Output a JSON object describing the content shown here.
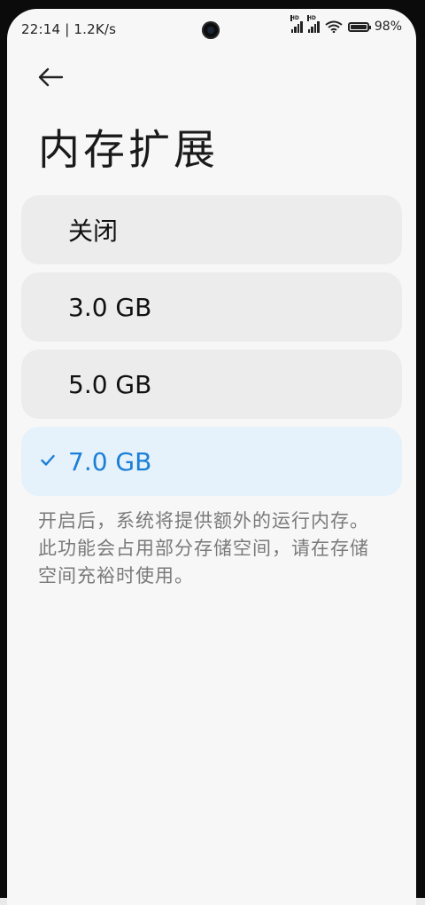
{
  "status_bar": {
    "time_speed": "22:14 | 1.2K/s",
    "battery_percent": "98%",
    "battery_level": 0.98,
    "signal_badge": "HD"
  },
  "page": {
    "title": "内存扩展",
    "back_icon": "arrow-left-icon"
  },
  "options": [
    {
      "label": "关闭",
      "selected": false
    },
    {
      "label": "3.0 GB",
      "selected": false
    },
    {
      "label": "5.0 GB",
      "selected": false
    },
    {
      "label": "7.0 GB",
      "selected": true
    }
  ],
  "description": "开启后，系统将提供额外的运行内存。此功能会占用部分存储空间，请在存储空间充裕时使用。",
  "colors": {
    "accent": "#1a7fd6",
    "selected_bg": "#e5f1fb",
    "option_bg": "#ececec",
    "description": "#7a7a7a"
  }
}
